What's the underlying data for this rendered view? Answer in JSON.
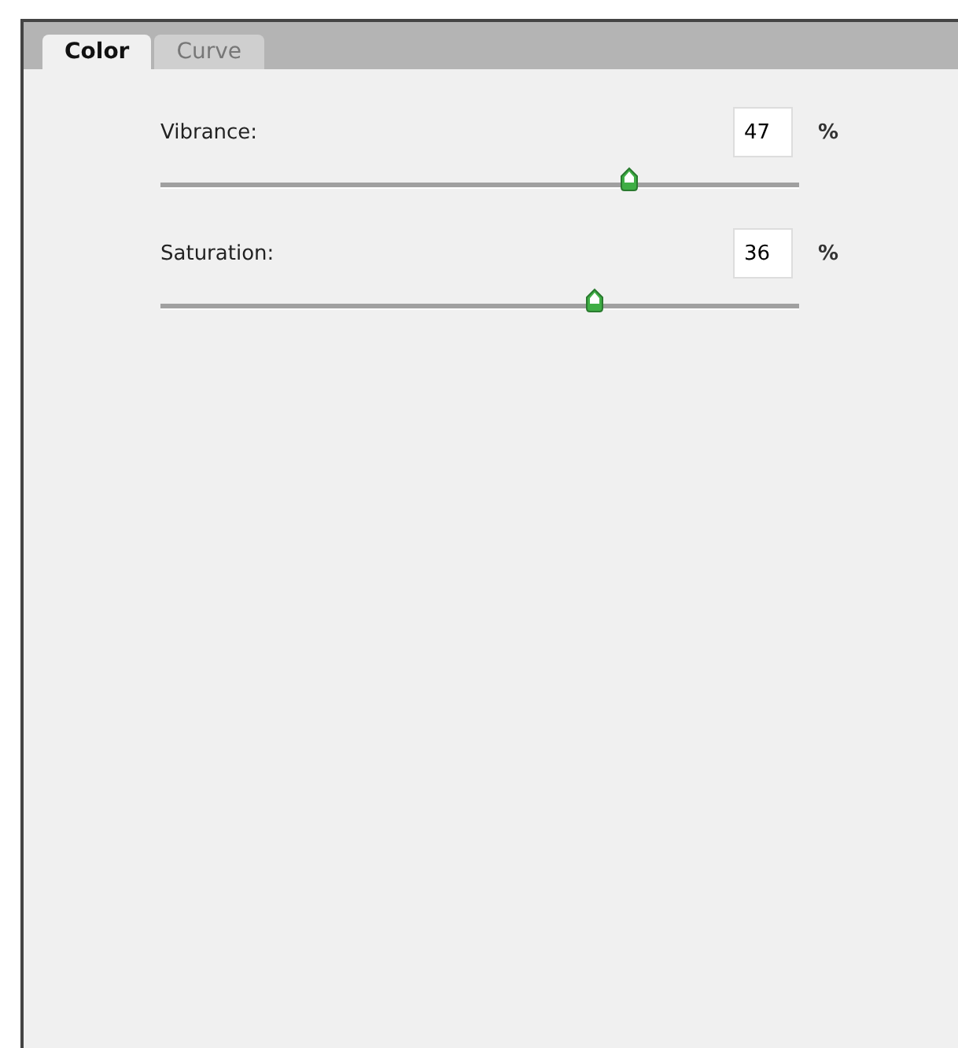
{
  "tabs": [
    {
      "label": "Color",
      "selected": true
    },
    {
      "label": "Curve",
      "selected": false
    }
  ],
  "sliders": [
    {
      "label": "Vibrance:",
      "value": "47",
      "unit": "%",
      "level": 0.735
    },
    {
      "label": "Saturation:",
      "value": "36",
      "unit": "%",
      "level": 0.68
    }
  ]
}
